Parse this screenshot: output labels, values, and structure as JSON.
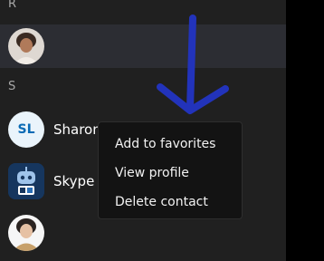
{
  "colors": {
    "panel_background": "#202020",
    "selected_row": "#2c2d33",
    "menu_background": "#131313",
    "annotation_arrow": "#2233bb",
    "initials_badge_text": "#0a6bb5"
  },
  "contact_list": {
    "sections": [
      {
        "letter": "R",
        "contacts": [
          {
            "name": "",
            "avatar": "photo-avatar-woman",
            "selected": true
          }
        ]
      },
      {
        "letter": "S",
        "contacts": [
          {
            "name": "Sharon",
            "avatar": "initials-avatar",
            "initials": "SL"
          },
          {
            "name": "Skype T",
            "avatar": "skype-bot-avatar"
          },
          {
            "name": "",
            "avatar": "photo-avatar-woman-2"
          }
        ]
      }
    ]
  },
  "context_menu": {
    "items": [
      {
        "label": "Add to favorites"
      },
      {
        "label": "View profile"
      },
      {
        "label": "Delete contact"
      }
    ]
  },
  "annotation": {
    "icon": "arrow-down-annotation"
  }
}
